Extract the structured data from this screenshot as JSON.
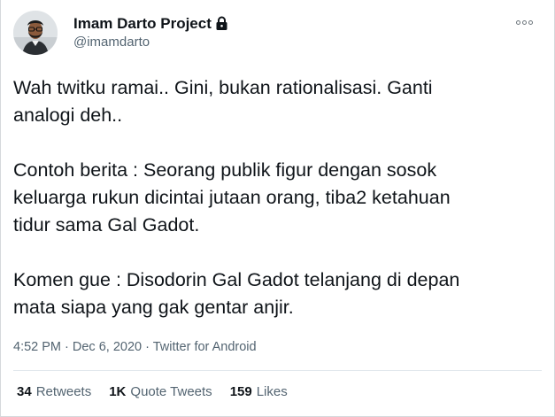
{
  "author": {
    "display_name": "Imam Darto Project",
    "handle": "@imamdarto",
    "avatar_icon": "person-avatar",
    "protected_icon": "lock-icon"
  },
  "tweet": {
    "paragraphs": [
      "Wah twitku ramai.. Gini, bukan rationalisasi. Ganti\nanalogi deh..",
      "Contoh berita : Seorang publik figur dengan sosok\nkeluarga rukun dicintai jutaan orang, tiba2 ketahuan\ntidur sama Gal Gadot.",
      "Komen gue : Disodorin Gal Gadot telanjang di depan\nmata siapa yang gak gentar anjir."
    ],
    "time": "4:52 PM",
    "date": "Dec 6, 2020",
    "source": "Twitter for Android",
    "separator": "·"
  },
  "stats": {
    "retweets_count": "34",
    "retweets_label": "Retweets",
    "quotes_count": "1K",
    "quotes_label": "Quote Tweets",
    "likes_count": "159",
    "likes_label": "Likes"
  },
  "colors": {
    "text_primary": "#0f1419",
    "text_secondary": "#536471",
    "divider": "#e1e8ed"
  }
}
